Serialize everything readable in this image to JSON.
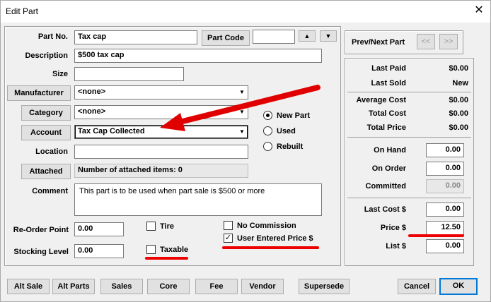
{
  "window": {
    "title": "Edit Part",
    "close_glyph": "✕"
  },
  "form": {
    "part_no_label": "Part No.",
    "part_no_value": "Tax cap",
    "part_code_button": "Part Code",
    "part_code_value": "",
    "description_label": "Description",
    "description_value": "$500 tax cap",
    "size_label": "Size",
    "size_value": "",
    "manufacturer_button": "Manufacturer",
    "manufacturer_value": "<none>",
    "category_button": "Category",
    "category_value": "<none>",
    "account_button": "Account",
    "account_value": "Tax Cap Collected",
    "location_label": "Location",
    "location_value": "",
    "attached_button": "Attached",
    "attached_text": "Number of attached items: 0",
    "comment_label": "Comment",
    "comment_value": "This part is to be used when part sale is $500 or more",
    "reorder_label": "Re-Order Point",
    "reorder_value": "0.00",
    "stocking_label": "Stocking Level",
    "stocking_value": "0.00"
  },
  "status_radios": [
    {
      "label": "New Part",
      "selected": true
    },
    {
      "label": "Used",
      "selected": false
    },
    {
      "label": "Rebuilt",
      "selected": false
    }
  ],
  "checkboxes": {
    "tire": {
      "label": "Tire",
      "checked": false
    },
    "taxable": {
      "label": "Taxable",
      "checked": false
    },
    "no_commission": {
      "label": "No Commission",
      "checked": false
    },
    "user_entered_price": {
      "label": "User Entered Price $",
      "checked": true
    }
  },
  "nav": {
    "label": "Prev/Next Part",
    "prev": "<<",
    "next": ">>"
  },
  "stats": [
    {
      "label": "Last Paid",
      "value": "$0.00"
    },
    {
      "label": "Last Sold",
      "value": "New"
    },
    {
      "label": "Average Cost",
      "value": "$0.00"
    },
    {
      "label": "Total Cost",
      "value": "$0.00"
    },
    {
      "label": "Total Price",
      "value": "$0.00"
    }
  ],
  "inventory": [
    {
      "label": "On Hand",
      "value": "0.00"
    },
    {
      "label": "On Order",
      "value": "0.00"
    },
    {
      "label": "Committed",
      "value": "0.00"
    }
  ],
  "pricing": [
    {
      "label": "Last Cost $",
      "value": "0.00"
    },
    {
      "label": "Price $",
      "value": "12.50"
    },
    {
      "label": "List $",
      "value": "0.00"
    }
  ],
  "footer": {
    "left_buttons": [
      "Alt Sale",
      "Alt Parts",
      "Sales",
      "Core",
      "Fee",
      "Vendor",
      "Supersede"
    ],
    "cancel": "Cancel",
    "ok": "OK"
  },
  "icons": {
    "up": "up-arrow-icon",
    "down": "down-arrow-icon",
    "dropdown": "dropdown-arrow-icon",
    "check": "checkmark-icon"
  },
  "colors": {
    "annotation_red": "#e00000",
    "ok_focus": "#0078d7"
  }
}
